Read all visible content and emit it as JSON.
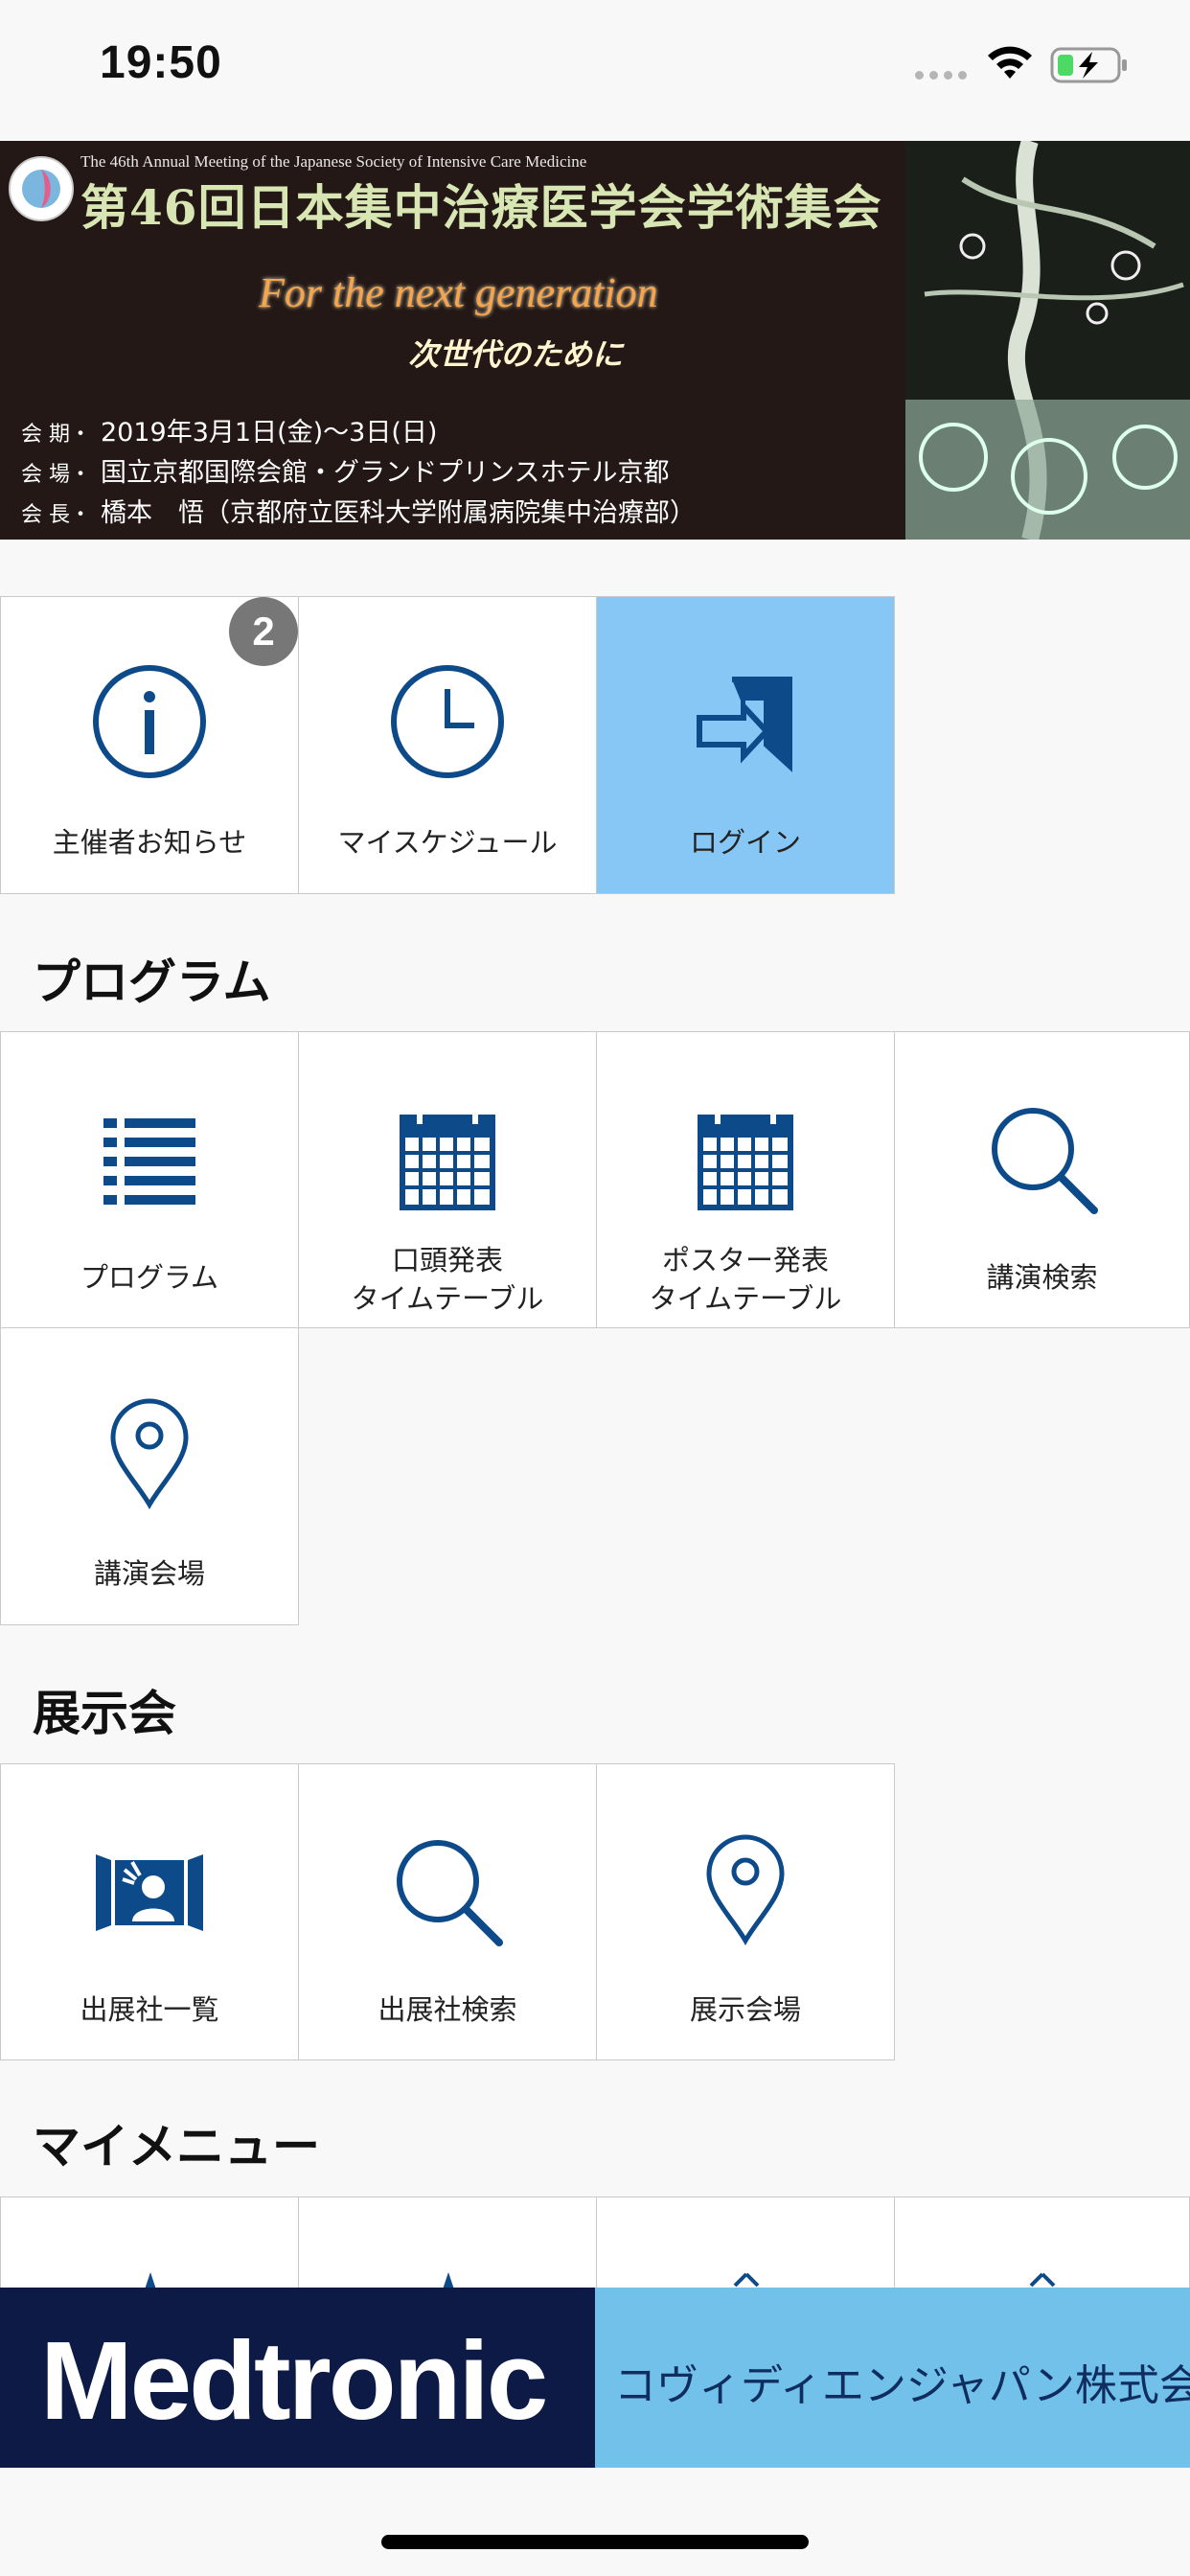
{
  "status_bar": {
    "time": "19:50"
  },
  "banner": {
    "subtitle": "The 46th Annual Meeting of the Japanese Society of Intensive Care Medicine",
    "title": "第46回日本集中治療医学会学術集会",
    "tagline_en": "For the next generation",
    "tagline_ja": "次世代のために",
    "date_label": "会 期・",
    "date": "2019年3月1日(金)〜3日(日)",
    "venue_label": "会 場・",
    "venue": "国立京都国際会館・グランドプリンスホテル京都",
    "president_label": "会 長・",
    "president": "橋本　悟（京都府立医科大学附属病院集中治療部）"
  },
  "top_menu": {
    "notice_label": "主催者お知らせ",
    "notice_badge": "2",
    "schedule_label": "マイスケジュール",
    "login_label": "ログイン"
  },
  "sections": {
    "program": "プログラム",
    "exhibition": "展示会",
    "my_menu": "マイメニュー"
  },
  "program_menu": {
    "program_label": "プログラム",
    "oral_line1": "口頭発表",
    "oral_line2": "タイムテーブル",
    "poster_line1": "ポスター発表",
    "poster_line2": "タイムテーブル",
    "search_label": "講演検索",
    "venue_label": "講演会場"
  },
  "exhibition_menu": {
    "exhibitors_label": "出展社一覧",
    "exhibitor_search_label": "出展社検索",
    "exhibition_venue_label": "展示会場"
  },
  "sponsors": {
    "left": "Medtronic",
    "right": "コヴィディエンジャパン株式会社"
  },
  "colors": {
    "icon_blue": "#0d4a8a",
    "login_bg": "#87c7f5",
    "sponsor_left_bg": "#0c1a45",
    "sponsor_right_bg": "#72c1ea"
  }
}
